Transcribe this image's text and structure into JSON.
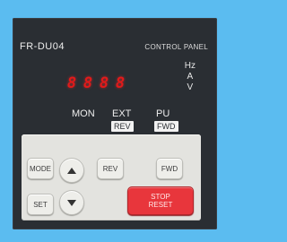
{
  "panel": {
    "model": "FR-DU04",
    "subtitle": "CONTROL PANEL",
    "display_digits": [
      "8",
      "8",
      "8",
      "8"
    ],
    "units": [
      "Hz",
      "A",
      "V"
    ],
    "modes": {
      "mon": "MON",
      "ext": "EXT",
      "pu": "PU",
      "rev_tag": "REV",
      "fwd_tag": "FWD"
    }
  },
  "keys": {
    "mode": "MODE",
    "set": "SET",
    "rev": "REV",
    "fwd": "FWD",
    "stop": "STOP",
    "reset": "RESET",
    "up_icon": "up-arrow-icon",
    "down_icon": "down-arrow-icon"
  },
  "colors": {
    "background": "#5bbcf0",
    "panel": "#2a2e33",
    "led": "#e21a1a",
    "stop_key": "#e8363c"
  }
}
